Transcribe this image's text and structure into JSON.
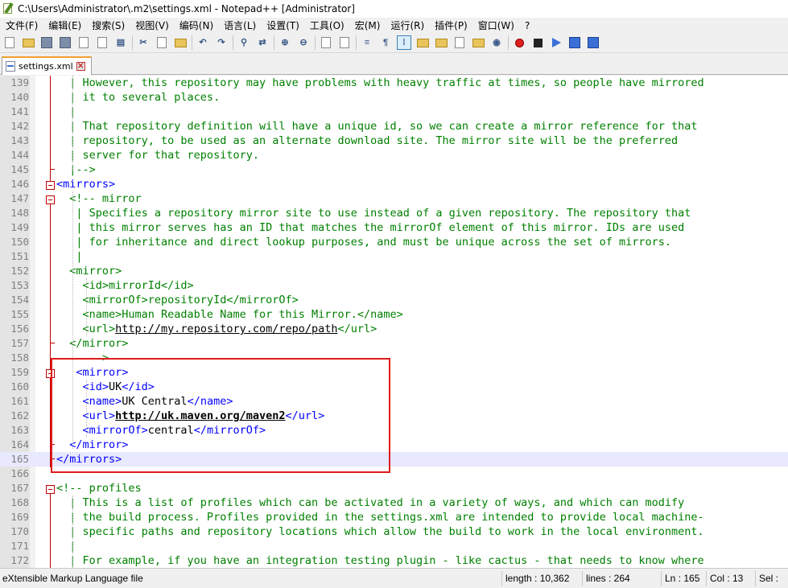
{
  "window": {
    "title": "C:\\Users\\Administrator\\.m2\\settings.xml - Notepad++ [Administrator]"
  },
  "menu": [
    "文件(F)",
    "编辑(E)",
    "搜索(S)",
    "视图(V)",
    "编码(N)",
    "语言(L)",
    "设置(T)",
    "工具(O)",
    "宏(M)",
    "运行(R)",
    "插件(P)",
    "窗口(W)",
    "?"
  ],
  "toolbar": {
    "icons": [
      "new-file-icon",
      "open-folder-icon",
      "save-icon",
      "save-all-icon",
      "close-icon",
      "close-all-icon",
      "print-icon",
      "cut-icon",
      "copy-icon",
      "paste-icon",
      "undo-icon",
      "redo-icon",
      "find-icon",
      "replace-icon",
      "zoom-in-icon",
      "zoom-out-icon",
      "sync-vertical-icon",
      "sync-horizontal-icon",
      "word-wrap-icon",
      "show-all-chars-icon",
      "indent-guide-icon",
      "user-language-icon",
      "doc-map-icon",
      "function-list-icon",
      "folder-as-workspace-icon",
      "monitoring-icon",
      "record-macro-icon",
      "stop-record-icon",
      "play-macro-icon",
      "run-macro-multiple-icon",
      "save-macro-icon"
    ]
  },
  "tab": {
    "label": "settings.xml",
    "close": "✕"
  },
  "editor": {
    "lines": [
      {
        "n": "139",
        "seg": [
          [
            "c",
            "  | However, this repository may have problems with heavy traffic at times, so people have mirrored"
          ]
        ]
      },
      {
        "n": "140",
        "seg": [
          [
            "c",
            "  | it to several places."
          ]
        ]
      },
      {
        "n": "141",
        "seg": [
          [
            "c",
            "  |"
          ]
        ]
      },
      {
        "n": "142",
        "seg": [
          [
            "c",
            "  | That repository definition will have a unique id, so we can create a mirror reference for that"
          ]
        ]
      },
      {
        "n": "143",
        "seg": [
          [
            "c",
            "  | repository, to be used as an alternate download site. The mirror site will be the preferred"
          ]
        ]
      },
      {
        "n": "144",
        "seg": [
          [
            "c",
            "  | server for that repository."
          ]
        ]
      },
      {
        "n": "145",
        "seg": [
          [
            "c",
            "  |-->"
          ]
        ]
      },
      {
        "n": "146",
        "seg": [
          [
            "t",
            "<mirrors>"
          ]
        ]
      },
      {
        "n": "147",
        "seg": [
          [
            "c",
            "  <!-- mirror"
          ]
        ]
      },
      {
        "n": "148",
        "seg": [
          [
            "c",
            "   | Specifies a repository mirror site to use instead of a given repository. The repository that"
          ]
        ]
      },
      {
        "n": "149",
        "seg": [
          [
            "c",
            "   | this mirror serves has an ID that matches the mirrorOf element of this mirror. IDs are used"
          ]
        ]
      },
      {
        "n": "150",
        "seg": [
          [
            "c",
            "   | for inheritance and direct lookup purposes, and must be unique across the set of mirrors."
          ]
        ]
      },
      {
        "n": "151",
        "seg": [
          [
            "c",
            "   |"
          ]
        ]
      },
      {
        "n": "152",
        "seg": [
          [
            "c",
            "  <mirror>"
          ]
        ]
      },
      {
        "n": "153",
        "seg": [
          [
            "c",
            "    <id>mirrorId</id>"
          ]
        ]
      },
      {
        "n": "154",
        "seg": [
          [
            "c",
            "    <mirrorOf>repositoryId</mirrorOf>"
          ]
        ]
      },
      {
        "n": "155",
        "seg": [
          [
            "c",
            "    <name>Human Readable Name for this Mirror.</name>"
          ]
        ]
      },
      {
        "n": "156",
        "seg": [
          [
            "c",
            "    <url>"
          ],
          [
            "cu",
            "http://my.repository.com/repo/path"
          ],
          [
            "c",
            "</url>"
          ]
        ]
      },
      {
        "n": "157",
        "seg": [
          [
            "c",
            "  </mirror>"
          ]
        ]
      },
      {
        "n": "158",
        "seg": [
          [
            "c",
            "     -->"
          ]
        ]
      },
      {
        "n": "159",
        "seg": [
          [
            "t",
            "   <mirror>"
          ]
        ]
      },
      {
        "n": "160",
        "seg": [
          [
            "t",
            "    <id>"
          ],
          [
            "x",
            "UK"
          ],
          [
            "t",
            "</id>"
          ]
        ]
      },
      {
        "n": "161",
        "seg": [
          [
            "t",
            "    <name>"
          ],
          [
            "x",
            "UK Central"
          ],
          [
            "t",
            "</name>"
          ]
        ]
      },
      {
        "n": "162",
        "seg": [
          [
            "t",
            "    <url>"
          ],
          [
            "ub",
            "http://uk.maven.org/maven2"
          ],
          [
            "t",
            "</url>"
          ]
        ]
      },
      {
        "n": "163",
        "seg": [
          [
            "t",
            "    <mirrorOf>"
          ],
          [
            "x",
            "central"
          ],
          [
            "t",
            "</mirrorOf>"
          ]
        ]
      },
      {
        "n": "164",
        "seg": [
          [
            "t",
            "  </mirror>"
          ]
        ]
      },
      {
        "n": "165",
        "seg": [
          [
            "t",
            "</mirrors>"
          ]
        ]
      },
      {
        "n": "166",
        "seg": [
          [
            "x",
            ""
          ]
        ]
      },
      {
        "n": "167",
        "seg": [
          [
            "c",
            "<!-- profiles"
          ]
        ]
      },
      {
        "n": "168",
        "seg": [
          [
            "c",
            "  | This is a list of profiles which can be activated in a variety of ways, and which can modify"
          ]
        ]
      },
      {
        "n": "169",
        "seg": [
          [
            "c",
            "  | the build process. Profiles provided in the settings.xml are intended to provide local machine-"
          ]
        ]
      },
      {
        "n": "170",
        "seg": [
          [
            "c",
            "  | specific paths and repository locations which allow the build to work in the local environment."
          ]
        ]
      },
      {
        "n": "171",
        "seg": [
          [
            "c",
            "  |"
          ]
        ]
      },
      {
        "n": "172",
        "seg": [
          [
            "c",
            "  | For example, if you have an integration testing plugin - like cactus - that needs to know where"
          ]
        ]
      }
    ]
  },
  "status": {
    "file_type": "eXtensible Markup Language file",
    "length": "length : 10,362",
    "lines": "lines : 264",
    "ln": "Ln : 165",
    "col": "Col : 13",
    "sel": "Sel :"
  }
}
